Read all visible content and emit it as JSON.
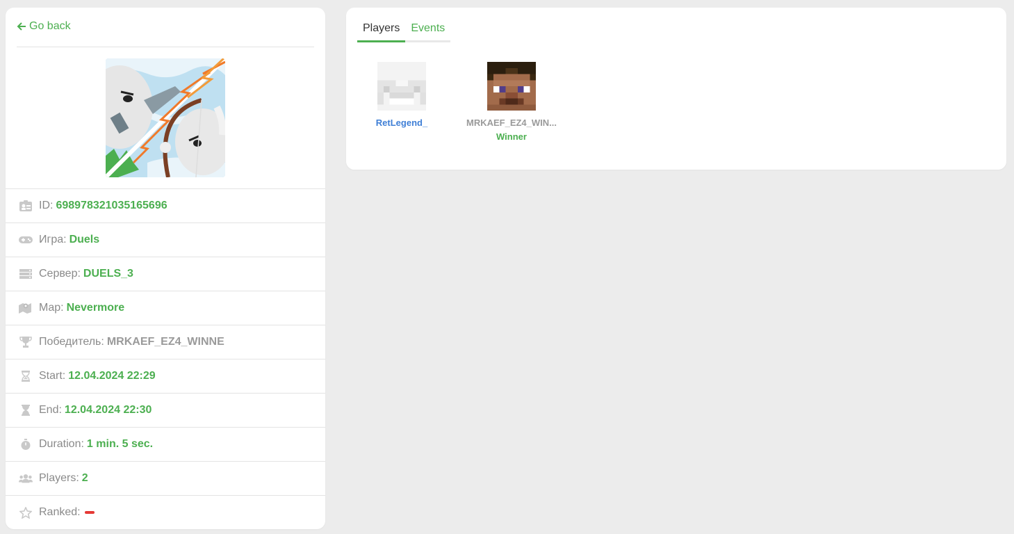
{
  "back_label": "Go back",
  "info_rows": [
    {
      "icon": "id-card-icon",
      "label": "ID:",
      "value": "698978321035165696"
    },
    {
      "icon": "gamepad-icon",
      "label": "Игра:",
      "value": "Duels"
    },
    {
      "icon": "server-icon",
      "label": "Сервер:",
      "value": "DUELS_3"
    },
    {
      "icon": "map-icon",
      "label": "Map:",
      "value": "Nevermore"
    },
    {
      "icon": "trophy-icon",
      "label": "Победитель:",
      "value": "MRKAEF_EZ4_WINNE"
    },
    {
      "icon": "hourglass-start-icon",
      "label": "Start:",
      "value": "12.04.2024 22:29"
    },
    {
      "icon": "hourglass-end-icon",
      "label": "End:",
      "value": "12.04.2024 22:30"
    },
    {
      "icon": "stopwatch-icon",
      "label": "Duration:",
      "value": "1 min. 5 sec."
    },
    {
      "icon": "users-icon",
      "label": "Players:",
      "value": "2"
    },
    {
      "icon": "star-icon",
      "label": "Ranked:",
      "value": ""
    }
  ],
  "tabs": [
    {
      "label": "Players",
      "active": true
    },
    {
      "label": "Events",
      "active": false
    }
  ],
  "players": [
    {
      "name": "RetLegend_",
      "status": ""
    },
    {
      "name": "MRKAEF_EZ4_WIN...",
      "status": "Winner"
    }
  ],
  "colors": {
    "accent": "#4caf50",
    "link": "#3f7fd6",
    "ranked_no": "#e53935"
  }
}
